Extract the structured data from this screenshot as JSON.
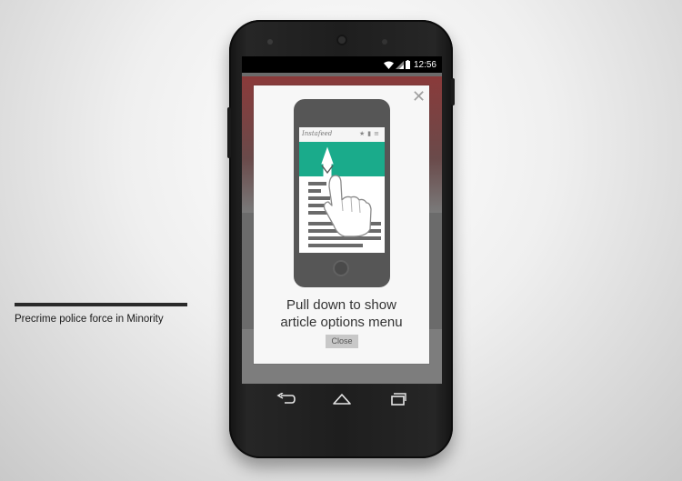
{
  "status_bar": {
    "time": "12:56",
    "icons": [
      "wifi-icon",
      "signal-icon",
      "battery-icon"
    ]
  },
  "background_article": {
    "visible_text": "Precrime police force in Minority"
  },
  "dialog": {
    "title_line1": "Pull down to show",
    "title_line2": "article options menu",
    "close_button_label": "Close",
    "dismiss_icon": "close-icon"
  },
  "illustration": {
    "app_logo_text": "Instafeed",
    "toolbar_icons": [
      "star-icon",
      "trash-icon",
      "menu-icon"
    ],
    "accent_color": "#1aab8b"
  },
  "nav_bar": {
    "icons": [
      "back-icon",
      "home-icon",
      "recent-apps-icon"
    ]
  }
}
